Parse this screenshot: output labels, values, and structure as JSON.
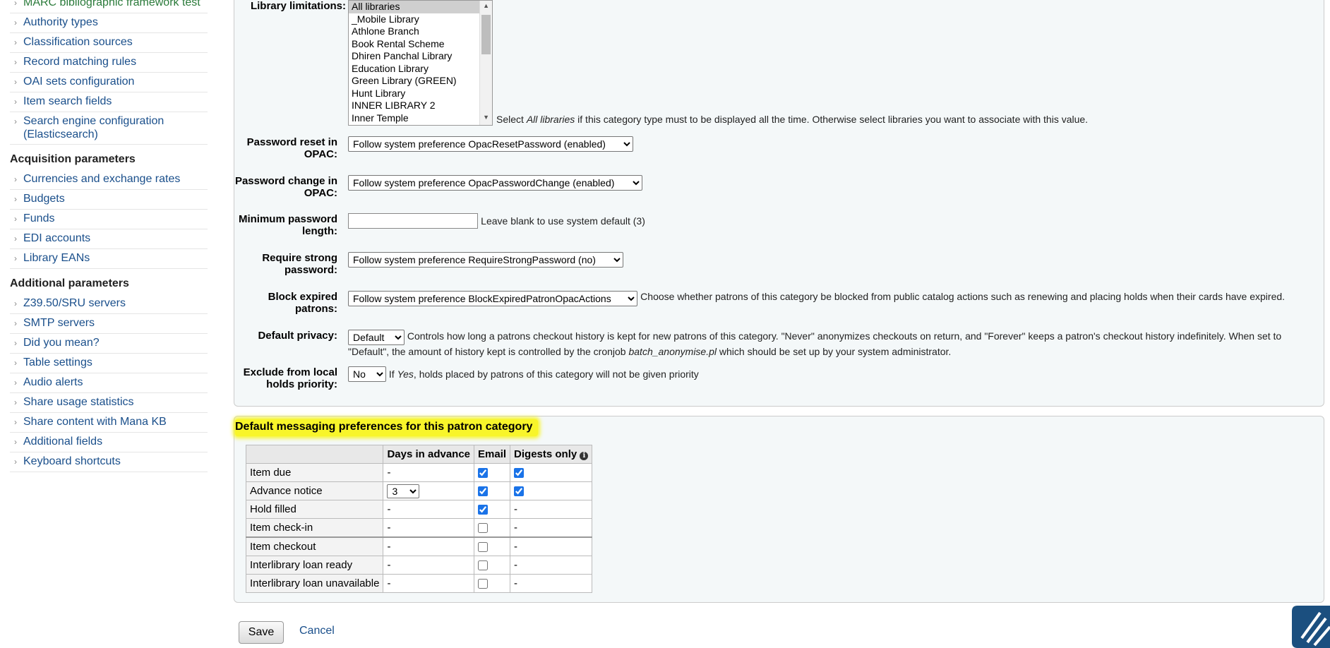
{
  "sidebar": {
    "cut_item": "MARC bibliographic framework test",
    "group1": [
      "Authority types",
      "Classification sources",
      "Record matching rules",
      "OAI sets configuration",
      "Item search fields",
      "Search engine configuration (Elasticsearch)"
    ],
    "acq_heading": "Acquisition parameters",
    "group2": [
      "Currencies and exchange rates",
      "Budgets",
      "Funds",
      "EDI accounts",
      "Library EANs"
    ],
    "add_heading": "Additional parameters",
    "group3": [
      "Z39.50/SRU servers",
      "SMTP servers",
      "Did you mean?",
      "Table settings",
      "Audio alerts",
      "Share usage statistics",
      "Share content with Mana KB",
      "Additional fields",
      "Keyboard shortcuts"
    ]
  },
  "form": {
    "library_limitations_label": "Library limitations:",
    "libraries": [
      "All libraries",
      "_Mobile Library",
      "Athlone Branch",
      "Book Rental Scheme",
      "Dhiren Panchal Library",
      "Education Library",
      "Green Library (GREEN)",
      "Hunt Library",
      "INNER LIBRARY 2",
      "Inner Temple"
    ],
    "lib_hint_pre": "Select ",
    "lib_hint_em": "All libraries",
    "lib_hint_post": " if this category type must to be displayed all the time. Otherwise select libraries you want to associate with this value.",
    "pw_reset_label": "Password reset in OPAC:",
    "pw_reset_value": "Follow system preference OpacResetPassword (enabled)",
    "pw_change_label": "Password change in OPAC:",
    "pw_change_value": "Follow system preference OpacPasswordChange (enabled)",
    "min_pw_label": "Minimum password length:",
    "min_pw_hint": "Leave blank to use system default (3)",
    "strong_pw_label": "Require strong password:",
    "strong_pw_value": "Follow system preference RequireStrongPassword (no)",
    "block_label": "Block expired patrons:",
    "block_value": "Follow system preference BlockExpiredPatronOpacActions",
    "block_hint": "Choose whether patrons of this category be blocked from public catalog actions such as renewing and placing holds when their cards have expired.",
    "privacy_label": "Default privacy:",
    "privacy_value": "Default",
    "privacy_hint_pre": "Controls how long a patrons checkout history is kept for new patrons of this category. \"Never\" anonymizes checkouts on return, and \"Forever\" keeps a patron's checkout history indefinitely. When set to \"Default\", the amount of history kept is controlled by the cronjob ",
    "privacy_hint_em": "batch_anonymise.pl",
    "privacy_hint_post": " which should be set up by your system administrator.",
    "exclude_label": "Exclude from local holds priority:",
    "exclude_value": "No",
    "exclude_hint_pre": "If ",
    "exclude_hint_em": "Yes",
    "exclude_hint_post": ", holds placed by patrons of this category will not be given priority"
  },
  "messaging": {
    "title": "Default messaging preferences for this patron category",
    "headers": [
      "",
      "Days in advance",
      "Email",
      "Digests only"
    ],
    "rows": [
      {
        "label": "Item due",
        "days": "-",
        "email": true,
        "digest": true
      },
      {
        "label": "Advance notice",
        "days": "3",
        "email": true,
        "digest": true
      },
      {
        "label": "Hold filled",
        "days": "-",
        "email": true,
        "digest": null
      },
      {
        "label": "Item check-in",
        "days": "-",
        "email": false,
        "digest": null
      },
      {
        "label": "Item checkout",
        "days": "-",
        "email": false,
        "digest": null
      },
      {
        "label": "Interlibrary loan ready",
        "days": "-",
        "email": false,
        "digest": null
      },
      {
        "label": "Interlibrary loan unavailable",
        "days": "-",
        "email": false,
        "digest": null
      }
    ],
    "dash": "-"
  },
  "actions": {
    "save": "Save",
    "cancel": "Cancel"
  },
  "colors": {
    "link": "#1a4f8b",
    "highlight": "#f8f52a",
    "fieldset_bg": "#f4f8f9"
  }
}
